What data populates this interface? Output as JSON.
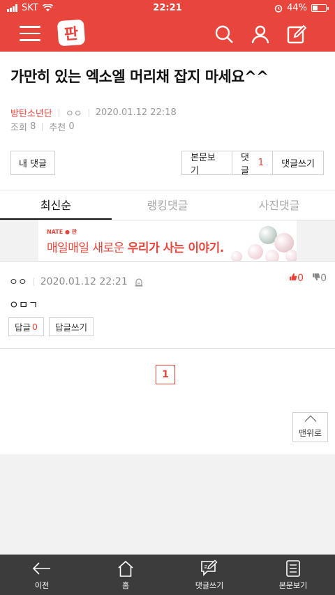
{
  "status_bar": {
    "carrier": "SKT",
    "time": "22:21",
    "battery": "44%",
    "battery_level": 0.44
  },
  "app_bar": {
    "logo_text": "판",
    "icons": [
      "menu-icon",
      "search-icon",
      "user-icon",
      "write-icon"
    ]
  },
  "post": {
    "title": "가만히 있는 엑소엘 머리채 잡지 마세요^^",
    "category": "방탄소년단",
    "author": "ㅇㅇ",
    "datetime": "2020.01.12 22:18",
    "views_label": "조회",
    "views": "8",
    "likes_label": "추천",
    "likes": "0"
  },
  "actions": {
    "my_comments": "내 댓글",
    "view_post": "본문보기",
    "comments_label": "댓글",
    "comments_count": "1",
    "write_comment": "댓글쓰기"
  },
  "tabs": [
    {
      "label": "최신순",
      "active": true
    },
    {
      "label": "랭킹댓글",
      "active": false
    },
    {
      "label": "사진댓글",
      "active": false
    }
  ],
  "banner": {
    "brand": "NATE ● 판",
    "text_normal": "매일매일 새로운 ",
    "text_bold": "우리가 사는 이야기."
  },
  "comment": {
    "author": "ㅇㅇ",
    "datetime": "2020.01.12 22:21",
    "up_count": "0",
    "down_count": "0",
    "body": "ㅇㅁㄱ",
    "reply_label": "답글",
    "reply_count": "0",
    "write_reply": "답글쓰기"
  },
  "pagination": {
    "current": "1"
  },
  "to_top": "맨위로",
  "bottom_nav": [
    {
      "label": "이전",
      "icon": "back-arrow-icon"
    },
    {
      "label": "홈",
      "icon": "home-icon"
    },
    {
      "label": "댓글쓰기",
      "icon": "comment-write-icon"
    },
    {
      "label": "본문보기",
      "icon": "document-icon"
    }
  ],
  "colors": {
    "brand": "#e8453c",
    "nav_bg": "#3c3c3c"
  }
}
